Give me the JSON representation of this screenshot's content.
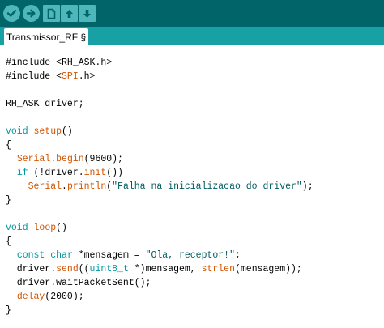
{
  "toolbar": {
    "buttons": [
      {
        "name": "verify",
        "icon": "checkmark-icon",
        "shape": "round"
      },
      {
        "name": "upload",
        "icon": "arrow-right-icon",
        "shape": "round"
      },
      {
        "name": "new",
        "icon": "new-file-icon",
        "shape": "square"
      },
      {
        "name": "open",
        "icon": "arrow-up-icon",
        "shape": "square"
      },
      {
        "name": "save",
        "icon": "arrow-down-icon",
        "shape": "square"
      }
    ],
    "colors": {
      "bar": "#006468",
      "button": "#4db7bb",
      "glyph": "#006468"
    }
  },
  "tabs": [
    {
      "label": "Transmissor_RF §",
      "active": true
    }
  ],
  "tabbar_color": "#17a1a5",
  "code": {
    "lines": [
      [
        {
          "t": "#include <RH_ASK.h>",
          "c": "plain"
        }
      ],
      [
        {
          "t": "#include <",
          "c": "plain"
        },
        {
          "t": "SPI",
          "c": "fn"
        },
        {
          "t": ".h>",
          "c": "plain"
        }
      ],
      [],
      [
        {
          "t": "RH_ASK driver;",
          "c": "plain"
        }
      ],
      [],
      [
        {
          "t": "void",
          "c": "type"
        },
        {
          "t": " ",
          "c": "plain"
        },
        {
          "t": "setup",
          "c": "fn"
        },
        {
          "t": "()",
          "c": "plain"
        }
      ],
      [
        {
          "t": "{",
          "c": "plain"
        }
      ],
      [
        {
          "t": "  ",
          "c": "plain"
        },
        {
          "t": "Serial",
          "c": "fn"
        },
        {
          "t": ".",
          "c": "plain"
        },
        {
          "t": "begin",
          "c": "fn"
        },
        {
          "t": "(9600);",
          "c": "plain"
        }
      ],
      [
        {
          "t": "  ",
          "c": "plain"
        },
        {
          "t": "if",
          "c": "type"
        },
        {
          "t": " (!driver.",
          "c": "plain"
        },
        {
          "t": "init",
          "c": "fn"
        },
        {
          "t": "())",
          "c": "plain"
        }
      ],
      [
        {
          "t": "    ",
          "c": "plain"
        },
        {
          "t": "Serial",
          "c": "fn"
        },
        {
          "t": ".",
          "c": "plain"
        },
        {
          "t": "println",
          "c": "fn"
        },
        {
          "t": "(",
          "c": "plain"
        },
        {
          "t": "\"Falha na inicializacao do driver\"",
          "c": "str"
        },
        {
          "t": ");",
          "c": "plain"
        }
      ],
      [
        {
          "t": "}",
          "c": "plain"
        }
      ],
      [],
      [
        {
          "t": "void",
          "c": "type"
        },
        {
          "t": " ",
          "c": "plain"
        },
        {
          "t": "loop",
          "c": "fn"
        },
        {
          "t": "()",
          "c": "plain"
        }
      ],
      [
        {
          "t": "{",
          "c": "plain"
        }
      ],
      [
        {
          "t": "  ",
          "c": "plain"
        },
        {
          "t": "const",
          "c": "type"
        },
        {
          "t": " ",
          "c": "plain"
        },
        {
          "t": "char",
          "c": "type"
        },
        {
          "t": " *mensagem = ",
          "c": "plain"
        },
        {
          "t": "\"Ola, receptor!\"",
          "c": "str"
        },
        {
          "t": ";",
          "c": "plain"
        }
      ],
      [
        {
          "t": "  driver.",
          "c": "plain"
        },
        {
          "t": "send",
          "c": "fn"
        },
        {
          "t": "((",
          "c": "plain"
        },
        {
          "t": "uint8_t",
          "c": "type"
        },
        {
          "t": " *)mensagem, ",
          "c": "plain"
        },
        {
          "t": "strlen",
          "c": "fn"
        },
        {
          "t": "(mensagem));",
          "c": "plain"
        }
      ],
      [
        {
          "t": "  driver.waitPacketSent();",
          "c": "plain"
        }
      ],
      [
        {
          "t": "  ",
          "c": "plain"
        },
        {
          "t": "delay",
          "c": "fn"
        },
        {
          "t": "(2000);",
          "c": "plain"
        }
      ],
      [
        {
          "t": "}",
          "c": "plain"
        }
      ]
    ],
    "colors": {
      "plain": "#000000",
      "type": "#00979c",
      "fn": "#d35400",
      "str": "#005c5f"
    }
  }
}
